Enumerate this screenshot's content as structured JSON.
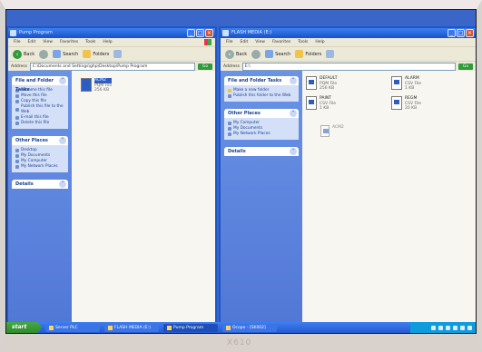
{
  "left_window": {
    "title": "Pump Program",
    "menu": [
      "File",
      "Edit",
      "View",
      "Favorites",
      "Tools",
      "Help"
    ],
    "toolbar": {
      "back": "Back",
      "search": "Search",
      "folders": "Folders"
    },
    "address_label": "Address",
    "address_value": "C:\\Documents and Settings\\ghp\\Desktop\\Pump Program",
    "go_label": "Go",
    "tasks_panel": {
      "title": "File and Folder Tasks",
      "items": [
        "Rename this file",
        "Move this file",
        "Copy this file",
        "Publish this file to the Web",
        "E-mail this file",
        "Delete this file"
      ]
    },
    "places_panel": {
      "title": "Other Places",
      "items": [
        "Desktop",
        "My Documents",
        "My Computer",
        "My Network Places"
      ]
    },
    "details_panel": {
      "title": "Details"
    },
    "files": [
      {
        "name": "ACM2",
        "type": "PQM File",
        "size": "256 KB"
      }
    ]
  },
  "right_window": {
    "title": "FLASH MEDIA (E:)",
    "menu": [
      "File",
      "Edit",
      "View",
      "Favorites",
      "Tools",
      "Help"
    ],
    "toolbar": {
      "back": "Back",
      "search": "Search",
      "folders": "Folders"
    },
    "address_label": "Address",
    "address_value": "E:\\",
    "go_label": "Go",
    "tasks_panel": {
      "title": "File and Folder Tasks",
      "items": [
        "Make a new folder",
        "Publish this folder to the Web"
      ]
    },
    "places_panel": {
      "title": "Other Places",
      "items": [
        "My Computer",
        "My Documents",
        "My Network Places"
      ]
    },
    "details_panel": {
      "title": "Details"
    },
    "files": [
      {
        "name": "DEFAULT",
        "type": "PQM File",
        "size": "256 KB"
      },
      {
        "name": "ALARM",
        "type": "CSV File",
        "size": "1 KB"
      },
      {
        "name": "PAINT",
        "type": "CSV File",
        "size": "1 KB"
      },
      {
        "name": "REGM",
        "type": "CSV File",
        "size": "20 KB"
      }
    ],
    "drag_ghost_label": "ACM2"
  },
  "taskbar": {
    "start_label": "start",
    "tasks": [
      "Server PLC",
      "FLASH MEDIA (E:)",
      "Pump Program",
      "Ocope - [SK002]"
    ]
  },
  "bezel_text": "X610"
}
